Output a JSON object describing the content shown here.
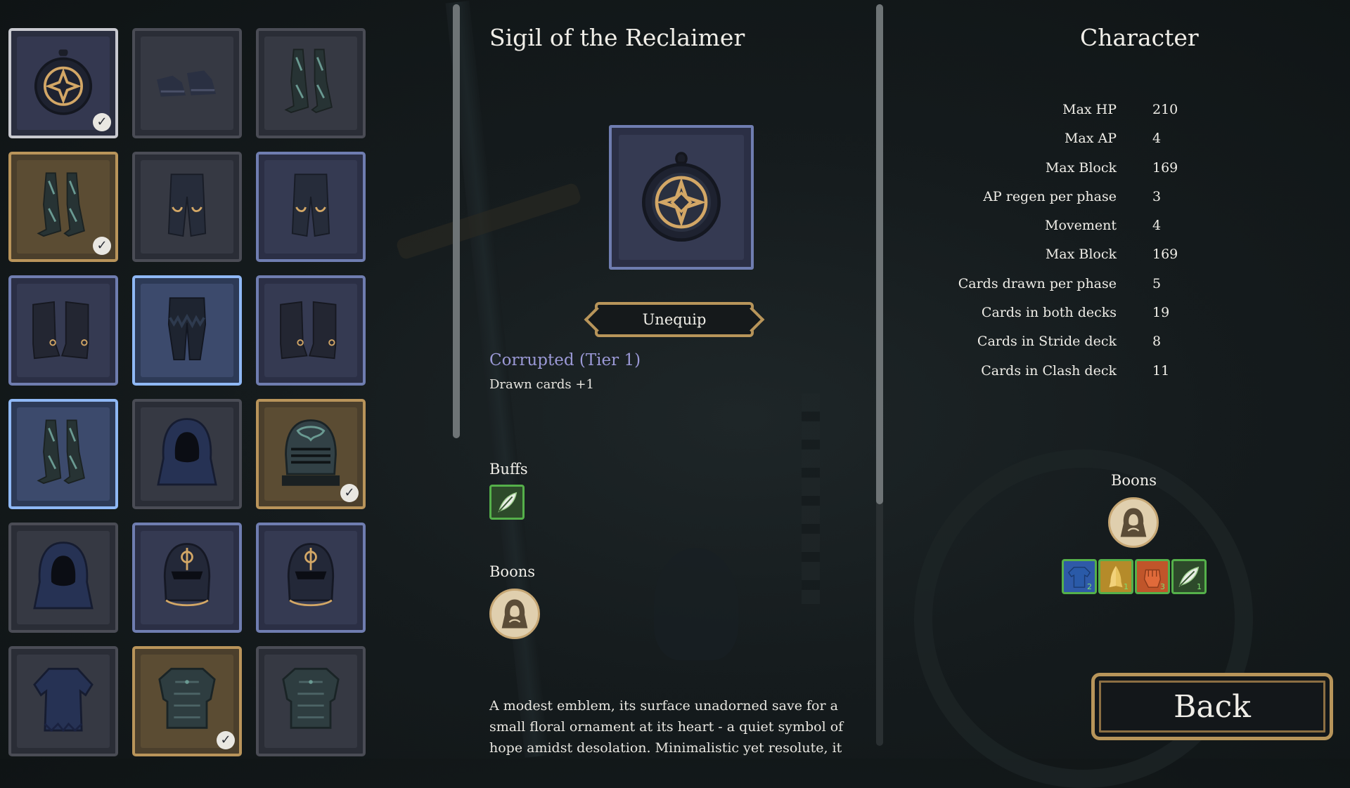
{
  "inventory": {
    "slots": [
      {
        "icon": "pendant-icon",
        "state": "selected",
        "equipped": true
      },
      {
        "icon": "shoes-icon",
        "state": "default",
        "equipped": false
      },
      {
        "icon": "greaves-icon",
        "state": "default",
        "equipped": false
      },
      {
        "icon": "greaves-icon",
        "state": "gold",
        "equipped": true
      },
      {
        "icon": "pants-icon",
        "state": "default",
        "equipped": false
      },
      {
        "icon": "pants-icon",
        "state": "blue",
        "equipped": false
      },
      {
        "icon": "boots-icon",
        "state": "blue",
        "equipped": false
      },
      {
        "icon": "tattered-pants-icon",
        "state": "hover",
        "equipped": false
      },
      {
        "icon": "boots-icon",
        "state": "blue",
        "equipped": false
      },
      {
        "icon": "greaves-icon",
        "state": "hover",
        "equipped": false
      },
      {
        "icon": "hood-icon",
        "state": "default",
        "equipped": false
      },
      {
        "icon": "ornate-helmet-icon",
        "state": "gold",
        "equipped": true
      },
      {
        "icon": "hood-icon",
        "state": "default",
        "equipped": false
      },
      {
        "icon": "knight-helmet-icon",
        "state": "blue",
        "equipped": false
      },
      {
        "icon": "knight-helmet-icon",
        "state": "blue",
        "equipped": false
      },
      {
        "icon": "tunic-icon",
        "state": "default",
        "equipped": false
      },
      {
        "icon": "chest-armor-icon",
        "state": "gold",
        "equipped": true
      },
      {
        "icon": "chest-armor-icon",
        "state": "default",
        "equipped": false
      }
    ],
    "check_glyph": "✓"
  },
  "detail": {
    "title": "Sigil of the Reclaimer",
    "icon": "pendant-icon",
    "unequip_label": "Unequip",
    "corrupted_label": "Corrupted (Tier 1)",
    "corrupted_effect": "Drawn cards +1",
    "buffs_label": "Buffs",
    "buff_icon": "feather-icon",
    "boons_label": "Boons",
    "boon_icon": "hooded-figure-icon",
    "description": "A modest emblem, its surface unadorned save for a small floral ornament at its heart - a quiet symbol of hope amidst desolation. Minimalistic yet resolute, it"
  },
  "character": {
    "title": "Character",
    "stats": [
      {
        "label": "Max HP",
        "value": "210"
      },
      {
        "label": "Max AP",
        "value": "4"
      },
      {
        "label": "Max Block",
        "value": "169"
      },
      {
        "label": "AP regen per phase",
        "value": "3"
      },
      {
        "label": "Movement",
        "value": "4"
      },
      {
        "label": "Max Block",
        "value": "169"
      },
      {
        "label": "Cards drawn per phase",
        "value": "5"
      },
      {
        "label": "Cards in both decks",
        "value": "19"
      },
      {
        "label": "Cards in Stride deck",
        "value": "8"
      },
      {
        "label": "Cards in Clash deck",
        "value": "11"
      }
    ],
    "boons_label": "Boons",
    "boon_icon": "hooded-figure-icon",
    "boon_badges": [
      {
        "icon": "shirt-icon",
        "color": "#2f5aa8",
        "count": "2"
      },
      {
        "icon": "praying-hands-icon",
        "color": "#b58b2a",
        "count": "1"
      },
      {
        "icon": "fist-icon",
        "color": "#c0552a",
        "count": "3"
      },
      {
        "icon": "feather-icon",
        "color": "#2d4a2a",
        "count": "1"
      }
    ]
  },
  "back_label": "Back",
  "colors": {
    "gold_border": "#b8955a",
    "blue_border": "#6f7db0",
    "buff_green": "#55b04a",
    "corrupted_text": "#9b99d6"
  }
}
